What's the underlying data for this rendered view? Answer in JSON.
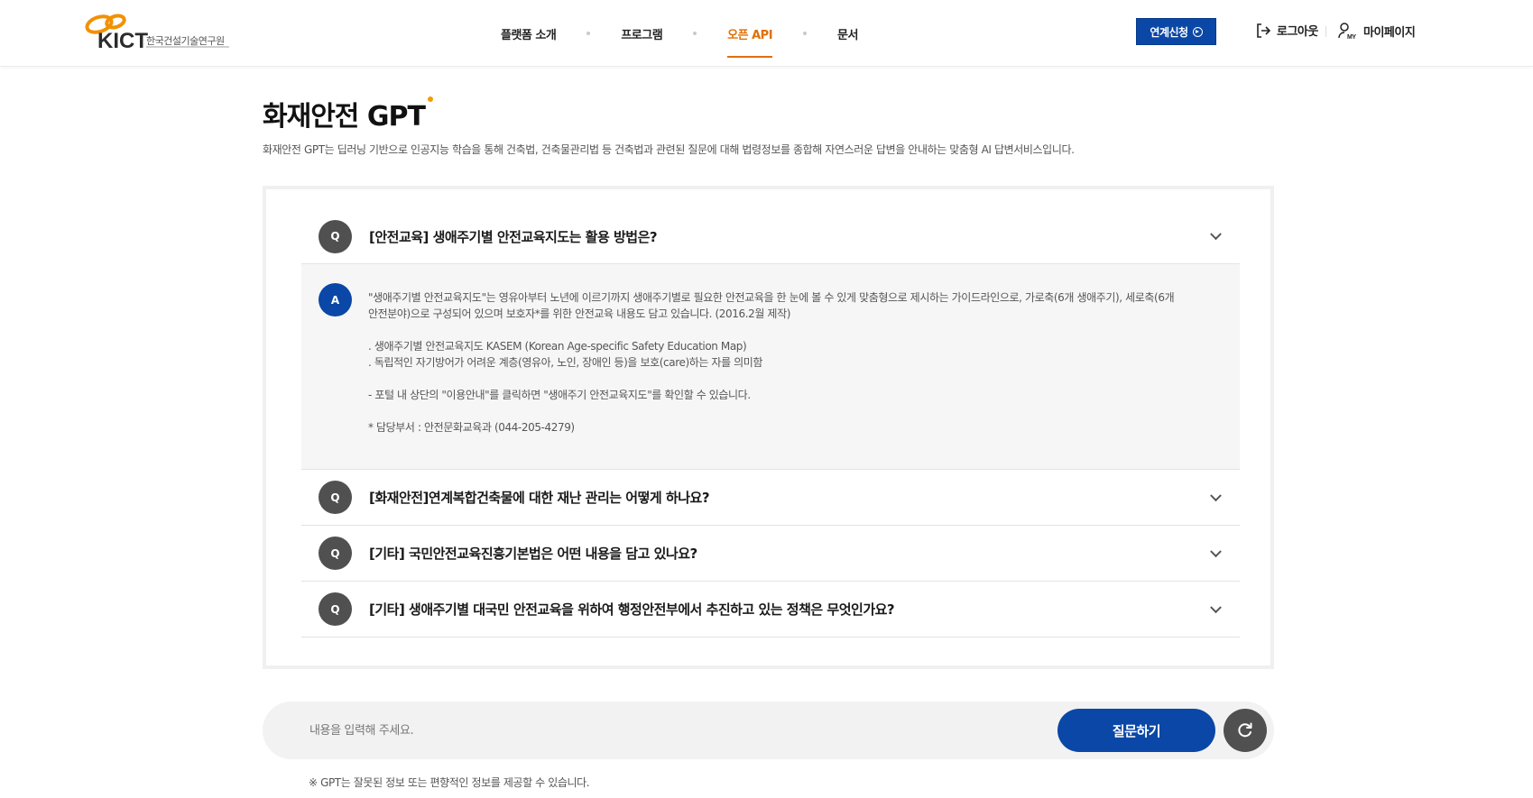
{
  "header": {
    "logo_text": "KICT",
    "logo_org": "한국건설기술연구원",
    "nav": [
      {
        "label": "플랫폼 소개",
        "active": false
      },
      {
        "label": "프로그램",
        "active": false
      },
      {
        "label": "오픈 API",
        "active": true
      },
      {
        "label": "문서",
        "active": false
      }
    ],
    "apply_label": "연계신청",
    "logout_label": "로그아웃",
    "mypage_label": "마이페이지",
    "mypage_icon_text": "MY"
  },
  "page": {
    "title": "화재안전 GPT",
    "description": "화재안전 GPT는 딥러닝 기반으로 인공지능 학습을 통해 건축법, 건축물관리법 등 건축법과 관련된 질문에 대해 법령정보를 종합해 자연스러운 답변을 안내하는 맞춤형 AI 답변서비스입니다."
  },
  "faq": {
    "q_badge": "Q",
    "a_badge": "A",
    "items": [
      {
        "question": "[안전교육] 생애주기별 안전교육지도는 활용 방법은?",
        "expanded": true
      },
      {
        "question": "[화재안전]연계복합건축물에 대한 재난 관리는 어떻게 하나요?",
        "expanded": false
      },
      {
        "question": "[기타] 국민안전교육진흥기본법은 어떤 내용을 담고 있나요?",
        "expanded": false
      },
      {
        "question": "[기타] 생애주기별 대국민 안전교육을 위하여 행정안전부에서 추진하고 있는 정책은 무엇인가요?",
        "expanded": false
      }
    ],
    "answer_lines": {
      "l1": "\"생애주기별 안전교육지도\"는 영유아부터 노년에 이르기까지 생애주기별로 필요한 안전교육을 한 눈에 볼 수 있게 맞춤형으로 제시하는 가이드라인으로, 가로축(6개 생애주기), 세로축(6개",
      "l2": "안전분야)으로 구성되어 있으며 보호자*를 위한 안전교육 내용도 담고 있습니다. (2016.2월 제작)",
      "l3": ". 생애주기별 안전교육지도 KASEM (Korean Age-specific Safety Education Map)",
      "l4": ". 독립적인 자기방어가 어려운 계층(영유아, 노인, 장애인 등)을 보호(care)하는 자를 의미함",
      "l5": "- 포털 내 상단의 \"이용안내\"를 클릭하면 \"생애주기 안전교육지도\"를 확인할 수 있습니다.",
      "l6": "* 담당부서 : 안전문화교육과 (044-205-4279)"
    }
  },
  "input": {
    "placeholder": "내용을 입력해 주세요.",
    "value": "",
    "ask_label": "질문하기"
  },
  "notice": "※ GPT는 잘못된 정보 또는 편향적인 정보를 제공할 수 있습니다.",
  "colors": {
    "primary": "#0a47a7",
    "accent": "#e07000",
    "badge_dark": "#505050"
  }
}
